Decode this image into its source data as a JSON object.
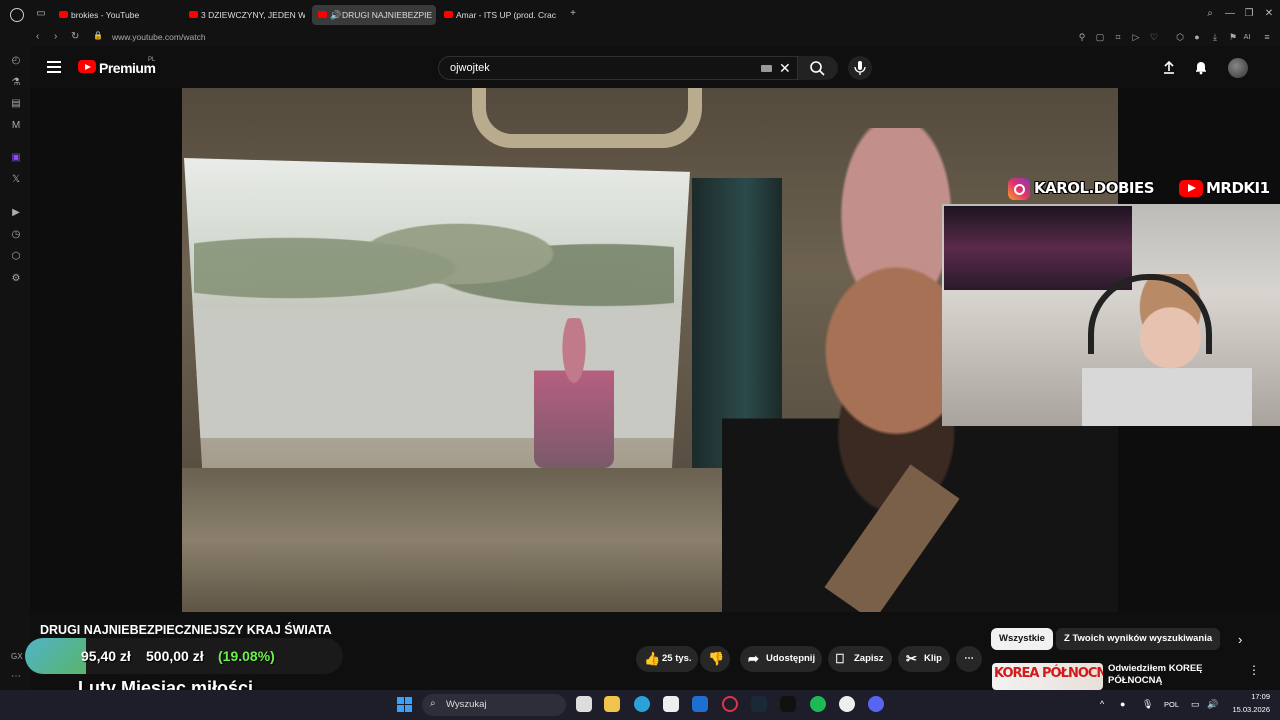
{
  "browser": {
    "tabs": [
      {
        "title": "brokies - YouTube"
      },
      {
        "title": "3 DZIEWCZYNY, JEDEN W"
      },
      {
        "title": "DRUGI NAJNIEBEZPIE"
      },
      {
        "title": "Amar - ITS UP (prod. Crac"
      }
    ],
    "new_tab_label": "+",
    "url": "www.youtube.com/watch",
    "toolbar_ai_label": "AI"
  },
  "youtube": {
    "brand": "Premium",
    "region": "PL",
    "search_value": "ojwojtek",
    "overlay": {
      "instagram_handle": "KAROL.DOBIES",
      "youtube_handle": "MRDKI1"
    },
    "video_title": "DRUGI NAJNIEBEZPIECZNIEJSZY KRAJ ŚWIATA",
    "actions": {
      "likes": "25 tys.",
      "share": "Udostępnij",
      "save": "Zapisz",
      "clip": "Klip"
    },
    "chips": [
      "Wszystkie",
      "Z Twoich wyników wyszukiwania"
    ],
    "recommendation": {
      "thumb_text": "KOREA PÓŁNOCNA",
      "title": "Odwiedziłem KOREĘ PÓŁNOCNĄ"
    }
  },
  "stream_widget": {
    "gx_label": "GX",
    "current": "95,40 zł",
    "goal": "500,00 zł",
    "percent": "(19.08%)",
    "progress_fraction": 0.1908,
    "ticker": "Luty Miesiąc miłości"
  },
  "taskbar": {
    "search_placeholder": "Wyszukaj",
    "lang": "POL",
    "time": "17:09",
    "date": "15.03.2026"
  },
  "colors": {
    "youtube_red": "#ff0000",
    "progress_green": "#6cf04a",
    "taskbar_bg": "#1e1d2a"
  }
}
